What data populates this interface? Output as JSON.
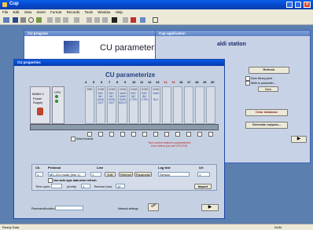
{
  "app": {
    "title": "Cup"
  },
  "menu": [
    "File",
    "Edit",
    "View",
    "Insert",
    "Format",
    "Records",
    "Tools",
    "Window",
    "Help"
  ],
  "program_window": {
    "title": "CU program",
    "heading": "CU parameterize progra"
  },
  "application_window": {
    "title": "Cup application",
    "station": "aldi station",
    "refresh": "Refresh",
    "check1": "Save library parts",
    "check2": "Write to parameter...",
    "new": "New",
    "clear_database": "Clear database",
    "generate_outputs": "Generate outputs..."
  },
  "properties": {
    "title": "CU properties",
    "heading": "CU parameterize",
    "slot_numbers": [
      "4",
      "5",
      "6",
      "7",
      "8",
      "9",
      "10",
      "11",
      "12",
      "13",
      "14",
      "15",
      "16",
      "17",
      "18",
      "19",
      "20"
    ],
    "power": {
      "name": "MABV-2",
      "l1": "Power",
      "l2": "Supply"
    },
    "cpu": "CPU",
    "modules": [
      {
        "name": "SPD"
      },
      {
        "name": "COM",
        "sub": "BEC\nBIC\nMON\nOUT"
      },
      {
        "name": "COM",
        "sub": "BEC\nBIC\nMON\nOUT"
      },
      {
        "name": "COM",
        "sub": "MAB\nMAB\nMON\nMOUT"
      },
      {
        "name": "COM",
        "sub": "BEC\nBIC\nCTRL"
      },
      {
        "name": "COM",
        "sub": "BEC\nBIC\nCTRL"
      },
      {
        "name": "COM",
        "sub": "SAM\n\nSLV"
      }
    ],
    "select_boards": "Select boards",
    "warning": "Your current status to parameterize\nfrom where you use CPU 016",
    "protocol_section": {
      "ch_label": "Ch.",
      "protocol_label": "Protocol",
      "line_label": "Line",
      "log_label": "Log text",
      "url_label": "Url",
      "ch_value": "1",
      "protocol_value": "MC-101 mode (line 1)",
      "line_value": "1",
      "edit": "Edit",
      "refresh": "Refresh",
      "parameter": "Parameter",
      "log_value": "Service",
      "url_value": "1",
      "checkbox_text": "Use write type data when refresh",
      "time_sync_label": "Time sync.",
      "priority_label": "priority",
      "timeout_label": "Timeout (ms)",
      "priority_value": "1",
      "timeout_value": "12",
      "import": "Import"
    },
    "placement_label": "Placement/location",
    "network_settings": "Network settings",
    "ok": "OK"
  },
  "statusbar": {
    "left": "Ready  Data",
    "right": "NUM"
  }
}
